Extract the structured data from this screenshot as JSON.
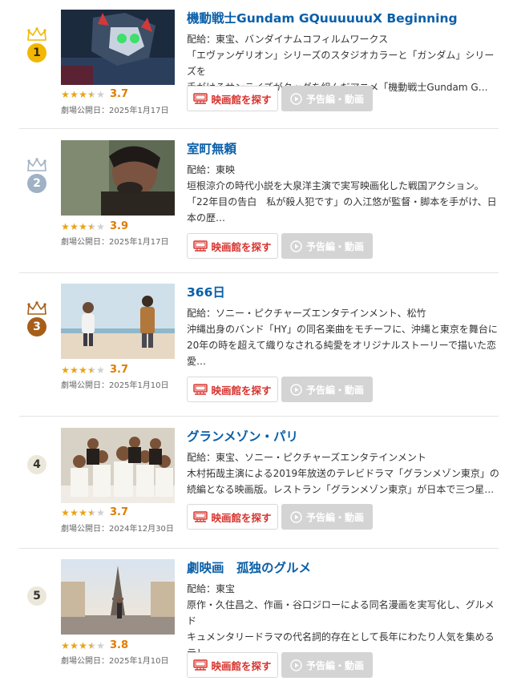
{
  "colors": {
    "title": "#0a5fa8",
    "star": "#e8a318",
    "score": "#e07b00",
    "theater_button_text": "#d8332e",
    "trailer_button_bg": "#d4d4d4",
    "rank1": "#f2b705",
    "rank2": "#9fb2c5",
    "rank3": "#a65e19",
    "rank_plain": "#ece8d9"
  },
  "movies": [
    {
      "rank": "1",
      "rank_style": "gold",
      "title": "機動戦士Gundam GQuuuuuuX Beginning",
      "distributor": "配給：東宝、バンダイナムコフィルムワークス",
      "description": [
        "「エヴァンゲリオン」シリーズのスタジオカラーと「ガンダム」シリーズを",
        "手がけるサンライズがタッグを組んだアニメ「機動戦士Gundam G…"
      ],
      "rating_value": 3.7,
      "rating": "3.7",
      "release": "劇場公開日：2025年1月17日",
      "theater_label": "映画館を探す",
      "trailer_label": "予告編・動画",
      "thumb_icon": "anime-mecha-thumbnail"
    },
    {
      "rank": "2",
      "rank_style": "silver",
      "title": "室町無頼",
      "distributor": "配給：東映",
      "description": [
        "垣根涼介の時代小説を大泉洋主演で実写映画化した戦国アクション。",
        "「22年目の告白　私が殺人犯です」の入江悠が監督・脚本を手がけ、日",
        "本の歴…"
      ],
      "rating_value": 3.9,
      "rating": "3.9",
      "release": "劇場公開日：2025年1月17日",
      "theater_label": "映画館を探す",
      "trailer_label": "予告編・動画",
      "thumb_icon": "samurai-actor-thumbnail"
    },
    {
      "rank": "3",
      "rank_style": "bronze",
      "title": "366日",
      "distributor": "配給：ソニー・ピクチャーズエンタテインメント、松竹",
      "description": [
        "沖縄出身のバンド「HY」の同名楽曲をモチーフに、沖縄と東京を舞台に",
        "20年の時を超えて織りなされる純愛をオリジナルストーリーで描いた恋",
        "愛…"
      ],
      "rating_value": 3.7,
      "rating": "3.7",
      "release": "劇場公開日：2025年1月10日",
      "theater_label": "映画館を探す",
      "trailer_label": "予告編・動画",
      "thumb_icon": "couple-beach-thumbnail"
    },
    {
      "rank": "4",
      "rank_style": "plain",
      "title": "グランメゾン・パリ",
      "distributor": "配給：東宝、ソニー・ピクチャーズエンタテインメント",
      "description": [
        "木村拓哉主演による2019年放送のテレビドラマ「グランメゾン東京」の",
        "続編となる映画版。レストラン「グランメゾン東京」が日本で三つ星…"
      ],
      "rating_value": 3.7,
      "rating": "3.7",
      "release": "劇場公開日：2024年12月30日",
      "theater_label": "映画館を探す",
      "trailer_label": "予告編・動画",
      "thumb_icon": "chefs-group-thumbnail"
    },
    {
      "rank": "5",
      "rank_style": "plain",
      "title": "劇映画　孤独のグルメ",
      "distributor": "配給：東宝",
      "description": [
        "原作・久住昌之、作画・谷口ジローによる同名漫画を実写化し、グルメド",
        "キュメンタリードラマの代名詞的存在として長年にわたり人気を集める",
        "テレ…"
      ],
      "rating_value": 3.8,
      "rating": "3.8",
      "release": "劇場公開日：2025年1月10日",
      "theater_label": "映画館を探す",
      "trailer_label": "予告編・動画",
      "thumb_icon": "paris-eiffel-thumbnail"
    }
  ]
}
